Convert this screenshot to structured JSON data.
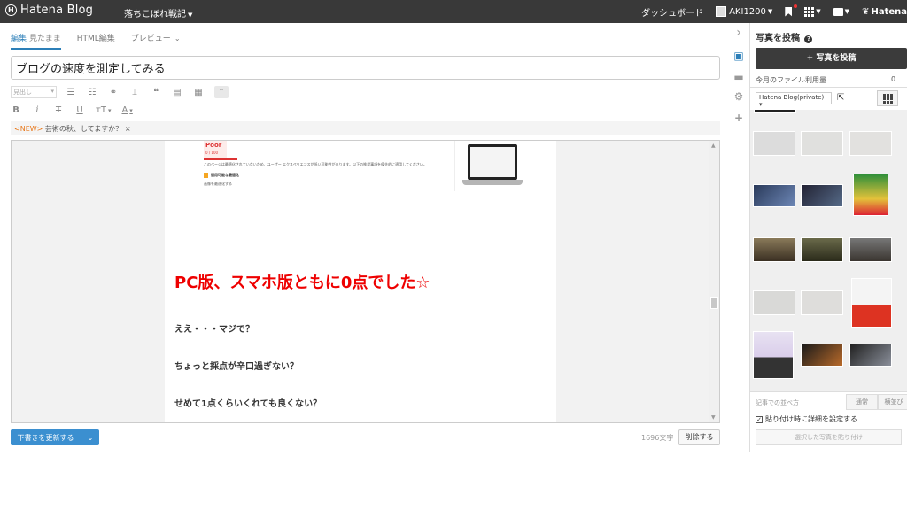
{
  "topbar": {
    "logo": "Hatena Blog",
    "logo_mark": "H",
    "blog_name": "落ちこぼれ戦記",
    "dashboard": "ダッシュボード",
    "user": "AKI1200",
    "brand_right": "Hatena"
  },
  "tabs": [
    {
      "label": "編集",
      "sub": "見たまま"
    },
    {
      "label": "HTML編集"
    },
    {
      "label": "プレビュー"
    }
  ],
  "title_value": "ブログの速度を測定してみる",
  "toolbar": {
    "heading_placeholder": "見出し"
  },
  "notice": {
    "new_label": "<NEW>",
    "text": "芸術の秋、してますか？",
    "close": "×"
  },
  "editor": {
    "embed": {
      "poor_label": "Poor",
      "poor_score": "0 / 100",
      "line1": "このページは最適化されていないため、ユーザー エクスペリエンスが低い可能性があります。以下の推奨事項を優先的に適用してください。",
      "heading": "適用可能な最適化",
      "sub": "画像を最適化する"
    },
    "headline": "PC版、スマホ版ともに0点でした☆",
    "paragraphs": [
      "ええ・・・マジで？",
      "ちょっと採点が辛口過ぎない？",
      "せめて1点くらいくれても良くない？"
    ]
  },
  "bottom": {
    "save_label": "下書きを更新する",
    "char_count": "1696文字",
    "delete_label": "削除する"
  },
  "panel": {
    "header": "写真を投稿",
    "help": "?",
    "post_button": "+ 写真を投稿",
    "usage_label": "今月のファイル利用量",
    "usage_value": "0",
    "album": "Hatena Blog(private)",
    "sort_label": "記事での並べ方",
    "sort_options": [
      "通常",
      "横並び"
    ],
    "checkbox_label": "貼り付け時に詳細を設定する",
    "paste_button": "選択した写真を貼り付け"
  },
  "colors": {
    "accent_blue": "#3b8fd0",
    "headline_red": "#e00000",
    "topbar": "#393939"
  }
}
